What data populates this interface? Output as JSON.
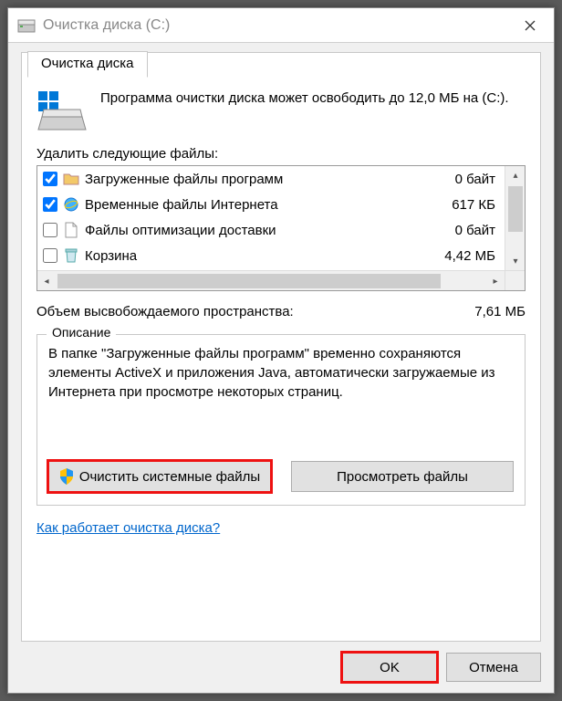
{
  "titlebar": {
    "title": "Очистка диска  (C:)"
  },
  "tab": {
    "label": "Очистка диска"
  },
  "intro": "Программа очистки диска может освободить до 12,0 МБ на  (C:).",
  "list_label": "Удалить следующие файлы:",
  "files": [
    {
      "checked": true,
      "icon": "folder",
      "label": "Загруженные файлы программ",
      "size": "0 байт"
    },
    {
      "checked": true,
      "icon": "ie",
      "label": "Временные файлы Интернета",
      "size": "617 КБ"
    },
    {
      "checked": false,
      "icon": "page",
      "label": "Файлы оптимизации доставки",
      "size": "0 байт"
    },
    {
      "checked": false,
      "icon": "bin",
      "label": "Корзина",
      "size": "4,42 МБ"
    }
  ],
  "total": {
    "label": "Объем высвобождаемого пространства:",
    "value": "7,61 МБ"
  },
  "description": {
    "legend": "Описание",
    "text": "В папке \"Загруженные файлы программ\" временно сохраняются элементы ActiveX и приложения Java, автоматически загружаемые из Интернета при просмотре некоторых страниц."
  },
  "buttons": {
    "clean_system": "Очистить системные файлы",
    "view_files": "Просмотреть файлы"
  },
  "link": "Как работает очистка диска?",
  "footer": {
    "ok": "OK",
    "cancel": "Отмена"
  }
}
